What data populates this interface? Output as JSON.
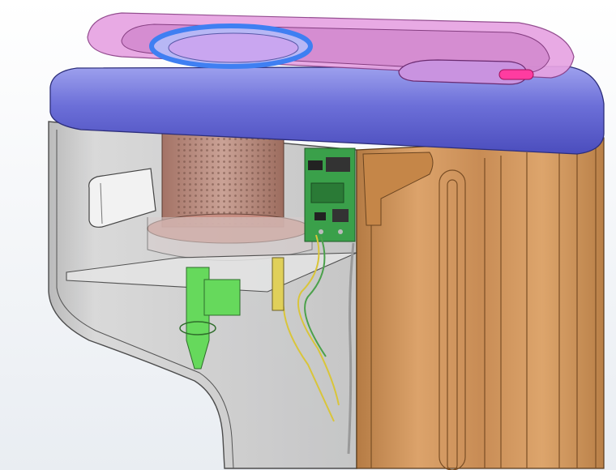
{
  "app": {
    "type": "3D CAD viewport"
  },
  "colors": {
    "background_top": "#ffffff",
    "background_bottom": "#e9edf2",
    "lid_purple": "#6c6fd8",
    "top_cover_pink": "#e7a3e2",
    "ring_blue": "#3f7ff2",
    "pink_button": "#ff3ca0",
    "shell_glass": "#c9c9c9",
    "body_orange": "#d29a62",
    "pcb_green": "#3aa04a",
    "sensor_green": "#66d95c",
    "wire_yellow": "#d9c53a",
    "filter_brown": "#b9877c"
  },
  "hud_toolbar": [
    {
      "name": "zoom-to-fit-icon",
      "dropdown": false
    },
    {
      "name": "zoom-to-area-icon",
      "dropdown": false
    },
    {
      "name": "previous-view-icon",
      "dropdown": false
    },
    {
      "name": "section-view-icon",
      "dropdown": false
    },
    {
      "name": "view-orientation-icon",
      "dropdown": true
    },
    {
      "name": "display-style-icon",
      "dropdown": true
    },
    {
      "name": "hide-show-items-icon",
      "dropdown": true
    },
    {
      "name": "edit-appearance-icon",
      "dropdown": false
    },
    {
      "name": "apply-scene-icon",
      "dropdown": true
    },
    {
      "name": "view-settings-icon",
      "dropdown": true
    }
  ],
  "model": {
    "components": [
      "top-cover",
      "lid-rim",
      "cup-opening-ring",
      "dispenser-slot",
      "pink-release-button",
      "transparent-shell",
      "orange-body",
      "perforated-filter",
      "pcb-board",
      "usb-port",
      "sensor-tube",
      "glass-shelf",
      "wires"
    ]
  }
}
